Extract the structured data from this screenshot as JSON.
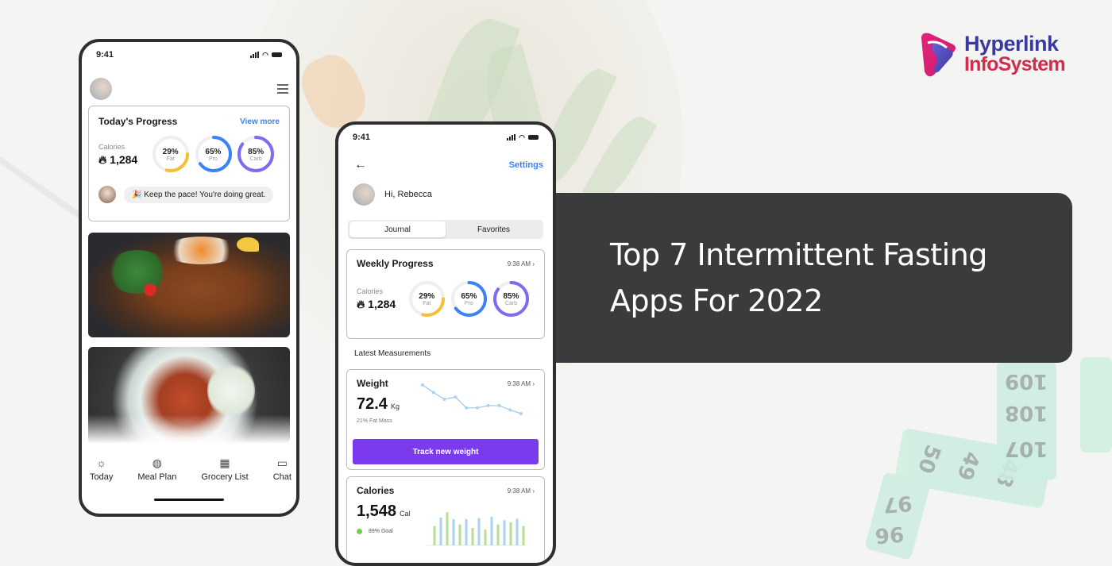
{
  "brand": {
    "line1": "Hyperlink",
    "line2": "InfoSystem",
    "colors": {
      "primary": "#3a3a9e",
      "secondary": "#d42c4e",
      "mark_pink": "#e5237a"
    }
  },
  "banner": {
    "title": "Top 7 Intermittent Fasting Apps For 2022",
    "bg_color": "#3a3b3d"
  },
  "phone1": {
    "status_time": "9:41",
    "progress_card": {
      "title": "Today's Progress",
      "link": "View more",
      "calories_label": "Calories",
      "calories_value": "1,284",
      "rings": [
        {
          "pct": "29%",
          "label": "Fat",
          "value": 0.29,
          "color": "#f5c036"
        },
        {
          "pct": "65%",
          "label": "Pro",
          "value": 0.65,
          "color": "#3b82f6"
        },
        {
          "pct": "85%",
          "label": "Carb",
          "value": 0.85,
          "color": "#7c6cf0"
        }
      ],
      "message": "🎉 Keep the pace! You're doing great."
    },
    "nav": [
      {
        "label": "Today",
        "icon": "sun-icon",
        "glyph": "☼"
      },
      {
        "label": "Meal Plan",
        "icon": "meal-plan-icon",
        "glyph": "◍"
      },
      {
        "label": "Grocery List",
        "icon": "grocery-basket-icon",
        "glyph": "▦"
      },
      {
        "label": "Chat",
        "icon": "chat-icon",
        "glyph": "▭"
      }
    ]
  },
  "phone2": {
    "status_time": "9:41",
    "back_glyph": "←",
    "settings": "Settings",
    "greeting": "Hi, Rebecca",
    "tabs": [
      {
        "label": "Journal",
        "active": true
      },
      {
        "label": "Favorites",
        "active": false
      }
    ],
    "weekly_card": {
      "title": "Weekly Progress",
      "time": "9:38 AM",
      "chevron": "›",
      "calories_label": "Calories",
      "calories_value": "1,284",
      "rings": [
        {
          "pct": "29%",
          "label": "Fat",
          "value": 0.29,
          "color": "#f5c036"
        },
        {
          "pct": "65%",
          "label": "Pro",
          "value": 0.65,
          "color": "#3b82f6"
        },
        {
          "pct": "85%",
          "label": "Carb",
          "value": 0.85,
          "color": "#7c6cf0"
        }
      ]
    },
    "section_title": "Latest Measurements",
    "weight_card": {
      "title": "Weight",
      "time": "9:38 AM",
      "chevron": "›",
      "value": "72.4",
      "unit": "Kg",
      "sub": "21% Fat Mass",
      "button": "Track new weight",
      "trend": [
        1.0,
        0.74,
        0.5,
        0.58,
        0.2,
        0.2,
        0.28,
        0.28,
        0.13,
        0.0
      ]
    },
    "calories_card": {
      "title": "Calories",
      "time": "9:38 AM",
      "chevron": "›",
      "value": "1,548",
      "unit": "Cal",
      "goal": "89% Goal",
      "bars": [
        0.55,
        0.8,
        0.95,
        0.75,
        0.6,
        0.75,
        0.5,
        0.78,
        0.45,
        0.82,
        0.6,
        0.72,
        0.66,
        0.76,
        0.55
      ],
      "bar_colors": [
        "#b9e08d",
        "#a9d3f2"
      ]
    }
  }
}
